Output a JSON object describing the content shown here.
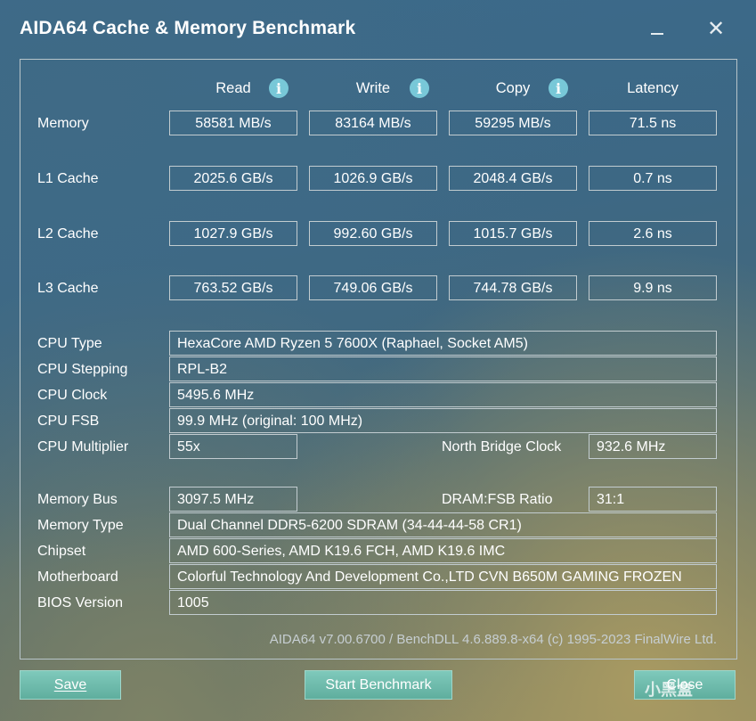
{
  "window": {
    "title": "AIDA64 Cache & Memory Benchmark",
    "close_glyph": "✕"
  },
  "columns": {
    "read": "Read",
    "write": "Write",
    "copy": "Copy",
    "latency": "Latency",
    "info_glyph": "i"
  },
  "rows": {
    "memory": {
      "label": "Memory",
      "read": "58581 MB/s",
      "write": "83164 MB/s",
      "copy": "59295 MB/s",
      "latency": "71.5 ns"
    },
    "l1": {
      "label": "L1 Cache",
      "read": "2025.6 GB/s",
      "write": "1026.9 GB/s",
      "copy": "2048.4 GB/s",
      "latency": "0.7 ns"
    },
    "l2": {
      "label": "L2 Cache",
      "read": "1027.9 GB/s",
      "write": "992.60 GB/s",
      "copy": "1015.7 GB/s",
      "latency": "2.6 ns"
    },
    "l3": {
      "label": "L3 Cache",
      "read": "763.52 GB/s",
      "write": "749.06 GB/s",
      "copy": "744.78 GB/s",
      "latency": "9.9 ns"
    }
  },
  "cpu": {
    "type_label": "CPU Type",
    "type_value": "HexaCore AMD Ryzen 5 7600X  (Raphael, Socket AM5)",
    "stepping_label": "CPU Stepping",
    "stepping_value": "RPL-B2",
    "clock_label": "CPU Clock",
    "clock_value": "5495.6 MHz",
    "fsb_label": "CPU FSB",
    "fsb_value": "99.9 MHz  (original: 100 MHz)",
    "multiplier_label": "CPU Multiplier",
    "multiplier_value": "55x",
    "nb_clock_label": "North Bridge Clock",
    "nb_clock_value": "932.6 MHz"
  },
  "memory_info": {
    "bus_label": "Memory Bus",
    "bus_value": "3097.5 MHz",
    "ratio_label": "DRAM:FSB Ratio",
    "ratio_value": "31:1",
    "type_label": "Memory Type",
    "type_value": "Dual Channel DDR5-6200 SDRAM  (34-44-44-58 CR1)",
    "chipset_label": "Chipset",
    "chipset_value": "AMD 600-Series, AMD K19.6 FCH, AMD K19.6 IMC",
    "motherboard_label": "Motherboard",
    "motherboard_value": "Colorful Technology And Development Co.,LTD CVN B650M GAMING FROZEN",
    "bios_label": "BIOS Version",
    "bios_value": "1005"
  },
  "footer": {
    "version": "AIDA64 v7.00.6700 / BenchDLL 4.6.889.8-x64  (c) 1995-2023 FinalWire Ltd."
  },
  "buttons": {
    "save": "Save",
    "start": "Start Benchmark",
    "close": "Close"
  },
  "watermark": "小黑盒"
}
